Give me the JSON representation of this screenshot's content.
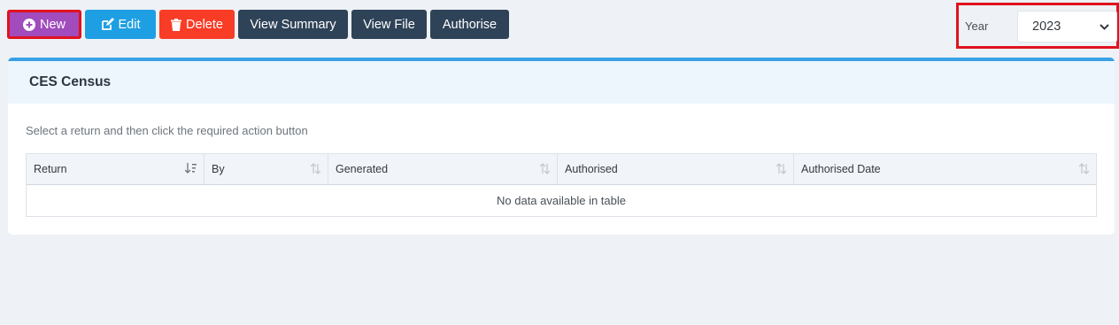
{
  "toolbar": {
    "new_label": "New",
    "edit_label": "Edit",
    "delete_label": "Delete",
    "view_summary_label": "View Summary",
    "view_file_label": "View File",
    "authorise_label": "Authorise"
  },
  "year": {
    "label": "Year",
    "selected": "2023"
  },
  "card": {
    "title": "CES Census",
    "hint": "Select a return and then click the required action button"
  },
  "table": {
    "columns": [
      "Return",
      "By",
      "Generated",
      "Authorised",
      "Authorised Date"
    ],
    "empty_message": "No data available in table"
  },
  "colors": {
    "new": "#a14bbd",
    "edit": "#1e9fe3",
    "delete": "#f83c26",
    "dark": "#2f4358",
    "highlight": "#e1121f",
    "accent": "#38a1e6"
  },
  "icons": {
    "new": "plus-circle-icon",
    "edit": "edit-icon",
    "delete": "trash-icon",
    "year_dropdown": "chevron-down-icon",
    "sort_active": "sort-amount-down-icon",
    "sort": "sort-icon"
  }
}
